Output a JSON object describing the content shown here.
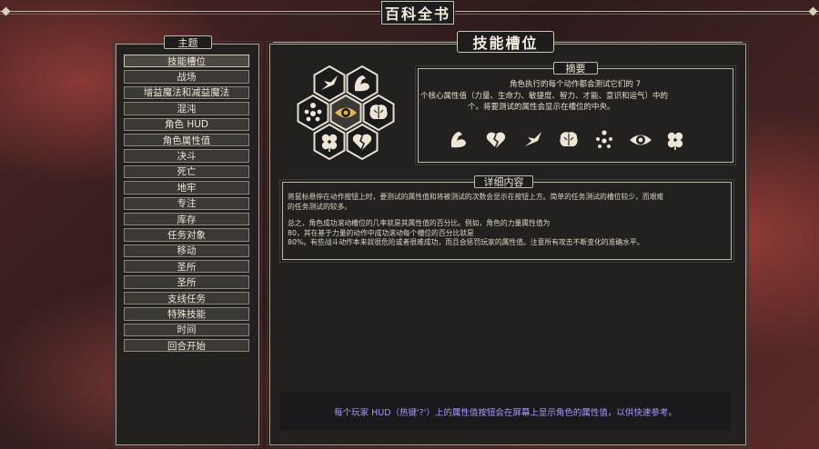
{
  "window": {
    "title": "百科全书"
  },
  "topics_header": "主题",
  "topics": [
    "技能槽位",
    "战场",
    "增益魔法和减益魔法",
    "混沌",
    "角色 HUD",
    "角色属性值",
    "决斗",
    "死亡",
    "地牢",
    "专注",
    "库存",
    "任务对象",
    "移动",
    "圣所",
    "圣所",
    "支线任务",
    "特殊技能",
    "时间",
    "回合开始"
  ],
  "active_topic_index": 0,
  "article": {
    "title": "技能槽位",
    "summary_title": "摘要",
    "summary_lines": [
      "角色执行的每个动作都会测试它们的 7",
      "个核心属性值（力量、生命力、敏捷度、智力、才能、意识和运气）中的",
      "个。将要测试的属性会显示在槽位的中央。"
    ],
    "detail_title": "详细内容",
    "detail_lines": [
      "将鼠标悬停在动作按钮上时，要测试的属性值和将被测试的次数会显示在按钮上方。简单的任务测试的槽位较少，而艰难",
      "的任务测试的较多。",
      "",
      "总之，角色成功滚动槽位的几率就是其属性值的百分比。例如，角色的力量属性值为",
      "80，其在基于力量的动作中成功滚动每个槽位的百分比就是",
      "80%。有些战斗动作本来就很危险或者很难成功，而且会惩罚玩家的属性值。注意所有攻击不断变化的准确水平。"
    ],
    "tip": "每个玩家 HUD（热键'?'）上的属性值按钮会在屏幕上显示角色的属性值，以供快速参考。"
  },
  "hex_icons": [
    "swift-bird-icon",
    "strength-arm-icon",
    "awareness-figure-icon",
    "eye-icon",
    "brain-icon",
    "luck-clover-icon",
    "vitality-heart-icon"
  ],
  "attribute_icons": [
    "strength-arm-icon",
    "vitality-heart-icon",
    "speed-bird-icon",
    "intellect-brain-icon",
    "talent-figure-icon",
    "awareness-eye-icon",
    "luck-clover-icon"
  ],
  "colors": {
    "panel": "#222120",
    "frame": "#a9a292",
    "icon": "#e9e3d4",
    "tip_text": "#a898ff"
  }
}
